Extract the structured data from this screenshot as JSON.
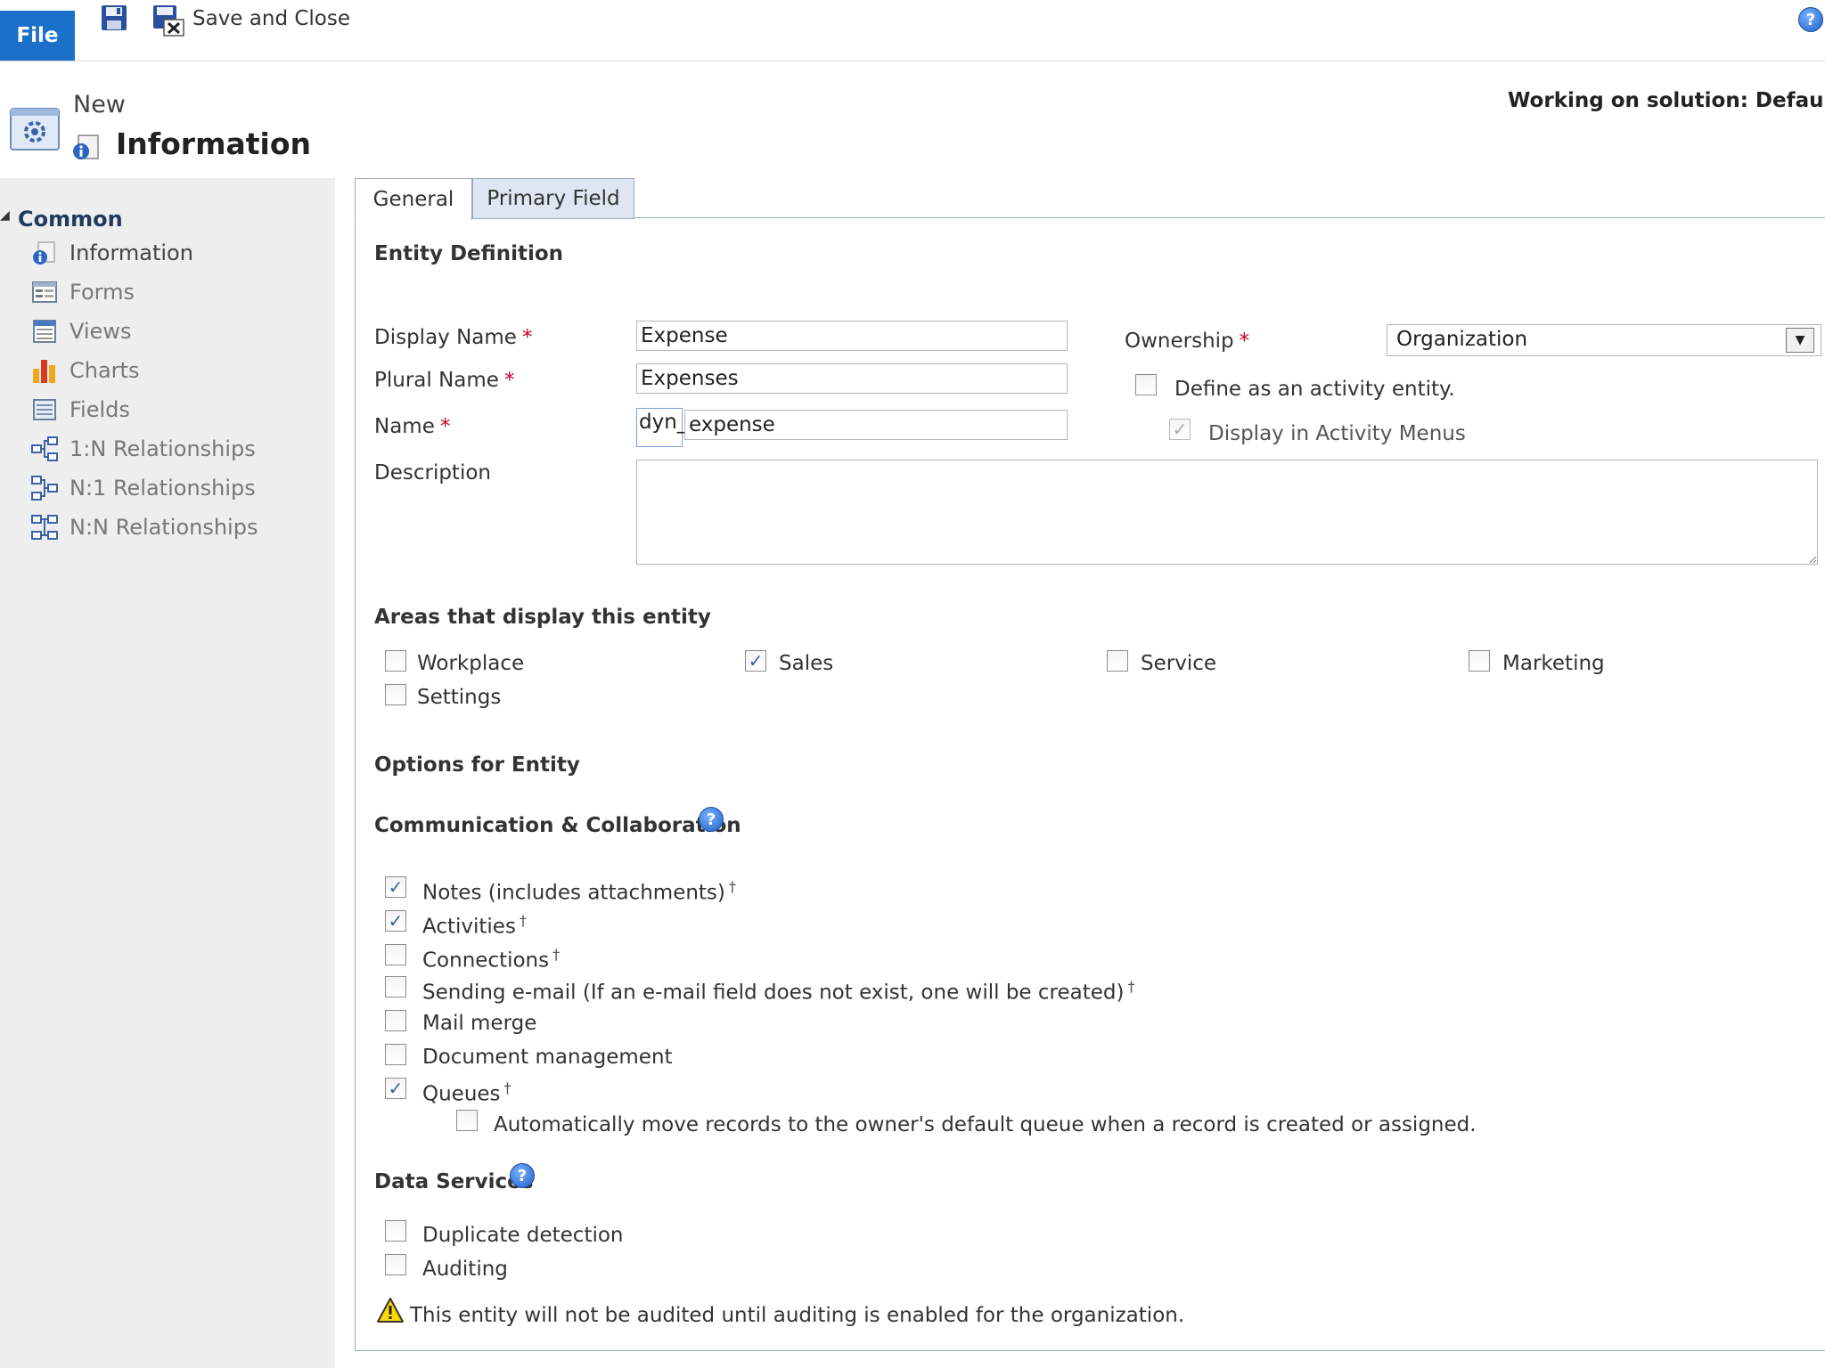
{
  "ribbon": {
    "file_label": "File",
    "save_close_label": "Save and Close"
  },
  "header": {
    "subtitle": "New",
    "title": "Information",
    "solution": "Working on solution: Default Sol"
  },
  "nav": {
    "group_label": "Common",
    "items": [
      {
        "label": "Information",
        "icon": "information-icon"
      },
      {
        "label": "Forms",
        "icon": "forms-icon"
      },
      {
        "label": "Views",
        "icon": "views-icon"
      },
      {
        "label": "Charts",
        "icon": "charts-icon"
      },
      {
        "label": "Fields",
        "icon": "fields-icon"
      },
      {
        "label": "1:N Relationships",
        "icon": "one-to-many-icon"
      },
      {
        "label": "N:1 Relationships",
        "icon": "many-to-one-icon"
      },
      {
        "label": "N:N Relationships",
        "icon": "many-to-many-icon"
      }
    ]
  },
  "tabs": [
    "General",
    "Primary Field"
  ],
  "entity_definition": {
    "title": "Entity Definition",
    "display_name_label": "Display Name",
    "display_name_value": "Expense",
    "plural_name_label": "Plural Name",
    "plural_name_value": "Expenses",
    "name_label": "Name",
    "name_prefix": "dyn_",
    "name_value": "expense",
    "description_label": "Description",
    "description_value": "",
    "ownership_label": "Ownership",
    "ownership_value": "Organization",
    "activity_label": "Define as an activity entity.",
    "activity_checked": false,
    "activity_menus_label": "Display in Activity Menus",
    "activity_menus_checked": true
  },
  "areas": {
    "title": "Areas that display this entity",
    "items": [
      {
        "label": "Workplace",
        "checked": false
      },
      {
        "label": "Sales",
        "checked": true
      },
      {
        "label": "Service",
        "checked": false
      },
      {
        "label": "Marketing",
        "checked": false
      },
      {
        "label": "Settings",
        "checked": false
      }
    ]
  },
  "options_title": "Options for Entity",
  "communication": {
    "title": "Communication & Collaboration",
    "items": [
      {
        "label": "Notes (includes attachments)",
        "checked": true,
        "dagger": "†"
      },
      {
        "label": "Activities",
        "checked": true,
        "dagger": "†"
      },
      {
        "label": "Connections",
        "checked": false,
        "dagger": "†"
      },
      {
        "label": "Sending e-mail (If an e-mail field does not exist, one will be created)",
        "checked": false,
        "dagger": "†"
      },
      {
        "label": "Mail merge",
        "checked": false,
        "dagger": ""
      },
      {
        "label": "Document management",
        "checked": false,
        "dagger": ""
      },
      {
        "label": "Queues",
        "checked": true,
        "dagger": "†"
      }
    ],
    "queue_auto_label": "Automatically move records to the owner's default queue when a record is created or assigned.",
    "queue_auto_checked": false
  },
  "data_services": {
    "title": "Data Services",
    "items": [
      {
        "label": "Duplicate detection",
        "checked": false
      },
      {
        "label": "Auditing",
        "checked": false
      }
    ],
    "warning": "This entity will not be audited until auditing is enabled for the organization."
  },
  "colors": {
    "file_button": "#1b71c9",
    "nav_background": "#eeeeee",
    "required": "#d0021b",
    "check": "#3560a8"
  }
}
